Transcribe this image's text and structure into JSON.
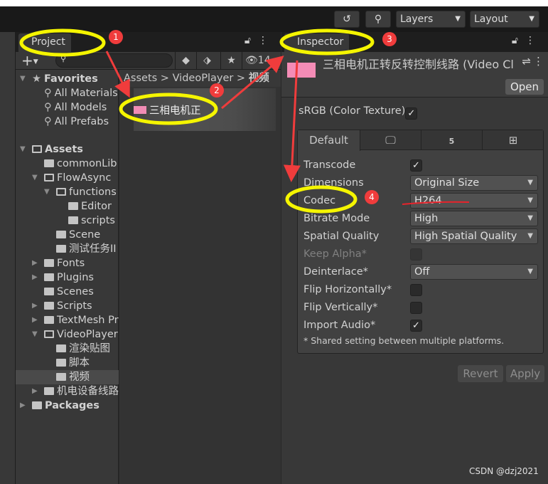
{
  "toolbar": {
    "layers": "Layers",
    "layout": "Layout"
  },
  "project": {
    "tab": "Project",
    "hidden_count": "14",
    "breadcrumb": [
      "Assets",
      "VideoPlayer",
      "视频"
    ],
    "selected_asset": "三相电机正",
    "tree": [
      {
        "label": "Favorites",
        "bold": true,
        "icon": "star-icon",
        "depth": 0,
        "arrow": "down"
      },
      {
        "label": "All Materials",
        "icon": "search-icon",
        "depth": 1
      },
      {
        "label": "All Models",
        "icon": "search-icon",
        "depth": 1
      },
      {
        "label": "All Prefabs",
        "icon": "search-icon",
        "depth": 1
      },
      {
        "label": "Assets",
        "bold": true,
        "icon": "folder-open-icon",
        "depth": 0,
        "arrow": "down"
      },
      {
        "label": "commonLib",
        "icon": "folder-icon",
        "depth": 1
      },
      {
        "label": "FlowAsync",
        "icon": "folder-open-icon",
        "depth": 1,
        "arrow": "down"
      },
      {
        "label": "functions",
        "icon": "folder-open-icon",
        "depth": 2,
        "arrow": "down"
      },
      {
        "label": "Editor",
        "icon": "folder-icon",
        "depth": 3
      },
      {
        "label": "scripts",
        "icon": "folder-icon",
        "depth": 3
      },
      {
        "label": "Scene",
        "icon": "folder-icon",
        "depth": 2
      },
      {
        "label": "测试任务II",
        "icon": "folder-icon",
        "depth": 2
      },
      {
        "label": "Fonts",
        "icon": "folder-icon",
        "depth": 1,
        "arrow": "right"
      },
      {
        "label": "Plugins",
        "icon": "folder-icon",
        "depth": 1,
        "arrow": "right"
      },
      {
        "label": "Scenes",
        "icon": "folder-icon",
        "depth": 1
      },
      {
        "label": "Scripts",
        "icon": "folder-icon",
        "depth": 1,
        "arrow": "right"
      },
      {
        "label": "TextMesh Pro",
        "icon": "folder-icon",
        "depth": 1,
        "arrow": "right"
      },
      {
        "label": "VideoPlayer",
        "icon": "folder-open-icon",
        "depth": 1,
        "arrow": "down"
      },
      {
        "label": "渲染贴图",
        "icon": "folder-icon",
        "depth": 2
      },
      {
        "label": "脚本",
        "icon": "folder-icon",
        "depth": 2
      },
      {
        "label": "视频",
        "icon": "folder-icon",
        "depth": 2,
        "selected": true
      },
      {
        "label": "机电设备线路",
        "icon": "folder-icon",
        "depth": 1,
        "arrow": "right"
      },
      {
        "label": "Packages",
        "bold": true,
        "icon": "folder-icon",
        "depth": 0,
        "arrow": "right"
      }
    ]
  },
  "inspector": {
    "tab": "Inspector",
    "title": "三相电机正转反转控制线路 (Video Clip)",
    "open": "Open",
    "srgb": "sRGB (Color Texture)",
    "srgb_checked": true,
    "platform_tabs": [
      "Default",
      "monitor-icon",
      "html5-icon",
      "windows-icon"
    ],
    "fields": [
      {
        "label": "Transcode",
        "type": "checkbox",
        "checked": true
      },
      {
        "label": "Dimensions",
        "type": "dropdown",
        "value": "Original Size"
      },
      {
        "label": "Codec",
        "type": "dropdown",
        "value": "H264"
      },
      {
        "label": "Bitrate Mode",
        "type": "dropdown",
        "value": "High"
      },
      {
        "label": "Spatial Quality",
        "type": "dropdown",
        "value": "High Spatial Quality"
      },
      {
        "label": "Keep Alpha*",
        "type": "checkbox",
        "checked": false,
        "disabled": true
      },
      {
        "label": "Deinterlace*",
        "type": "dropdown",
        "value": "Off"
      },
      {
        "label": "Flip Horizontally*",
        "type": "checkbox",
        "checked": false
      },
      {
        "label": "Flip Vertically*",
        "type": "checkbox",
        "checked": false
      },
      {
        "label": "Import Audio*",
        "type": "checkbox",
        "checked": true
      }
    ],
    "note": "* Shared setting between multiple platforms.",
    "revert": "Revert",
    "apply": "Apply"
  },
  "annotations": {
    "markers": [
      "1",
      "2",
      "3",
      "4"
    ],
    "highlight_color": "#f5f500",
    "arrow_color": "#f03c3c"
  },
  "watermark": "CSDN @dzj2021"
}
